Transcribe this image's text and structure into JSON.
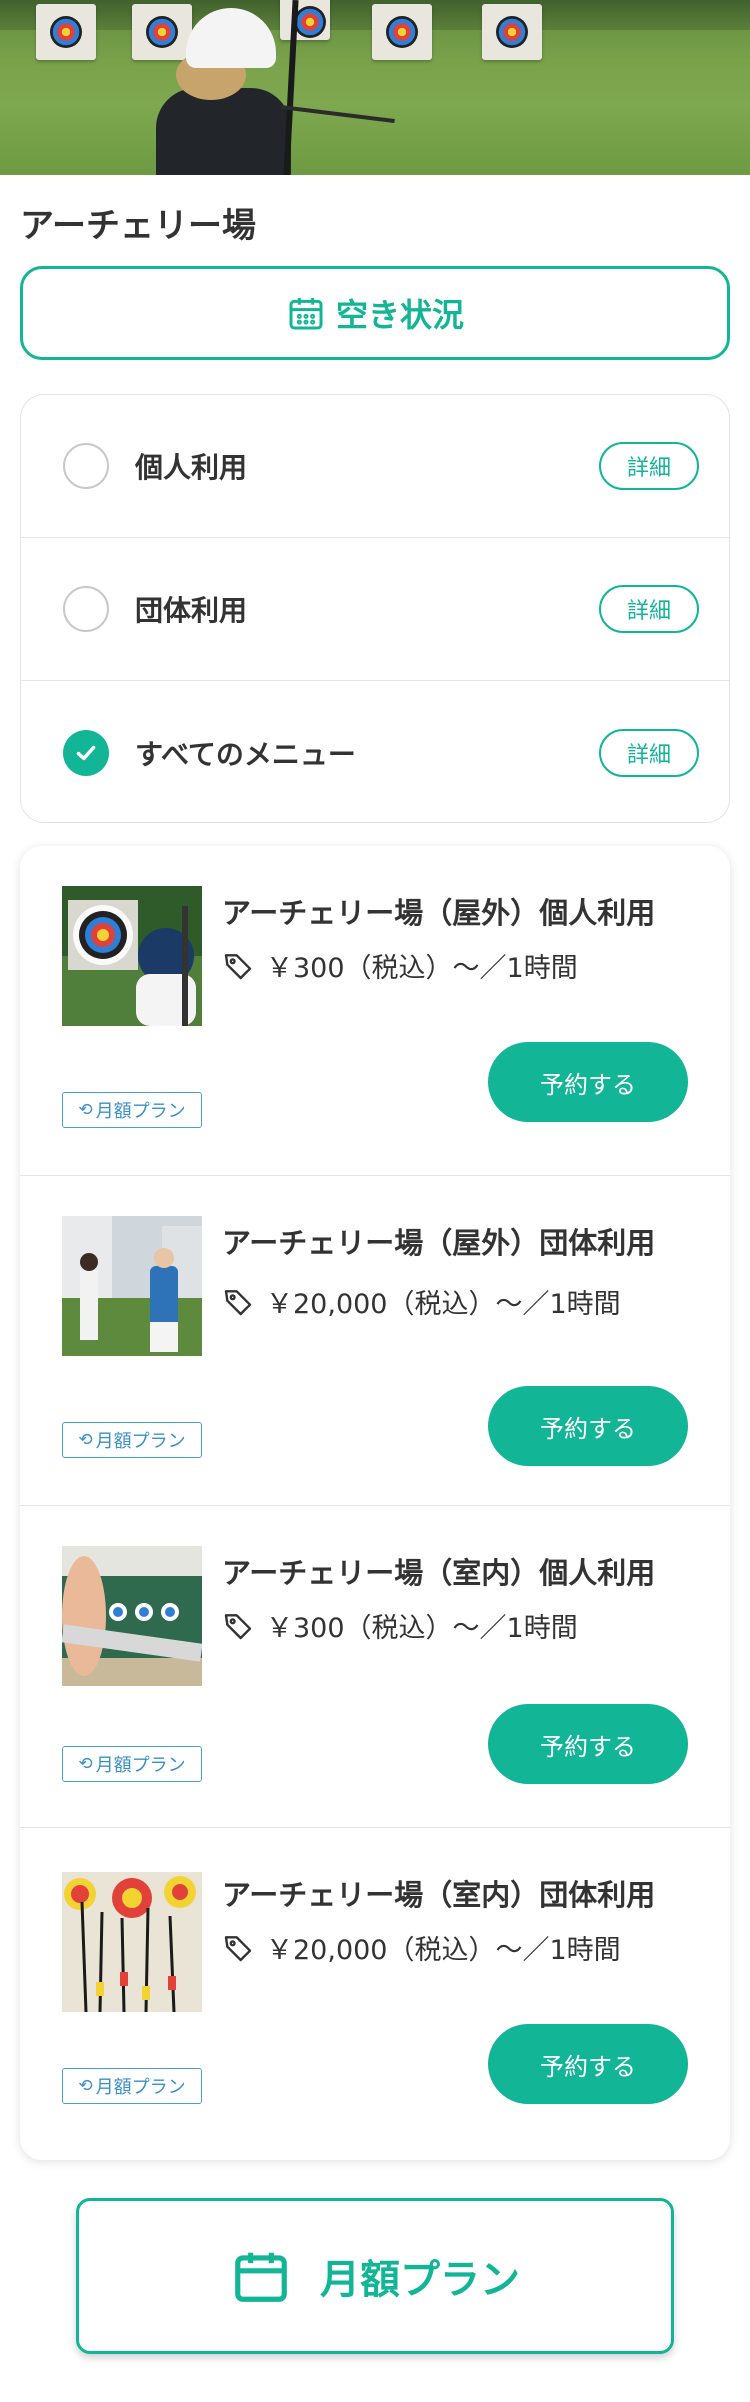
{
  "page": {
    "title": "アーチェリー場",
    "accent_color": "#12b595",
    "hero_image": "archer-outdoor-range-photo"
  },
  "vacancy_button": {
    "label": "空き状況",
    "icon": "calendar-icon"
  },
  "filters": [
    {
      "label": "個人利用",
      "checked": false,
      "detail_label": "詳細"
    },
    {
      "label": "団体利用",
      "checked": false,
      "detail_label": "詳細"
    },
    {
      "label": "すべてのメニュー",
      "checked": true,
      "detail_label": "詳細"
    }
  ],
  "menu_items": [
    {
      "title": "アーチェリー場（屋外）個人利用",
      "price": "￥300（税込）〜／1時間",
      "book_label": "予約する",
      "plan_tag": "月額プラン",
      "thumbnail": "outdoor-target-child-photo"
    },
    {
      "title": "アーチェリー場（屋外）団体利用",
      "price": "￥20,000（税込）〜／1時間",
      "book_label": "予約する",
      "plan_tag": "月額プラン",
      "thumbnail": "outdoor-archers-group-photo"
    },
    {
      "title": "アーチェリー場（室内）個人利用",
      "price": "￥300（税込）〜／1時間",
      "book_label": "予約する",
      "plan_tag": "月額プラン",
      "thumbnail": "indoor-archer-photo"
    },
    {
      "title": "アーチェリー場（室内）団体利用",
      "price": "￥20,000（税込）〜／1時間",
      "book_label": "予約する",
      "plan_tag": "月額プラン",
      "thumbnail": "indoor-arrows-targets-photo"
    }
  ],
  "monthly_plan_button": {
    "label": "月額プラン",
    "icon": "calendar-icon"
  }
}
